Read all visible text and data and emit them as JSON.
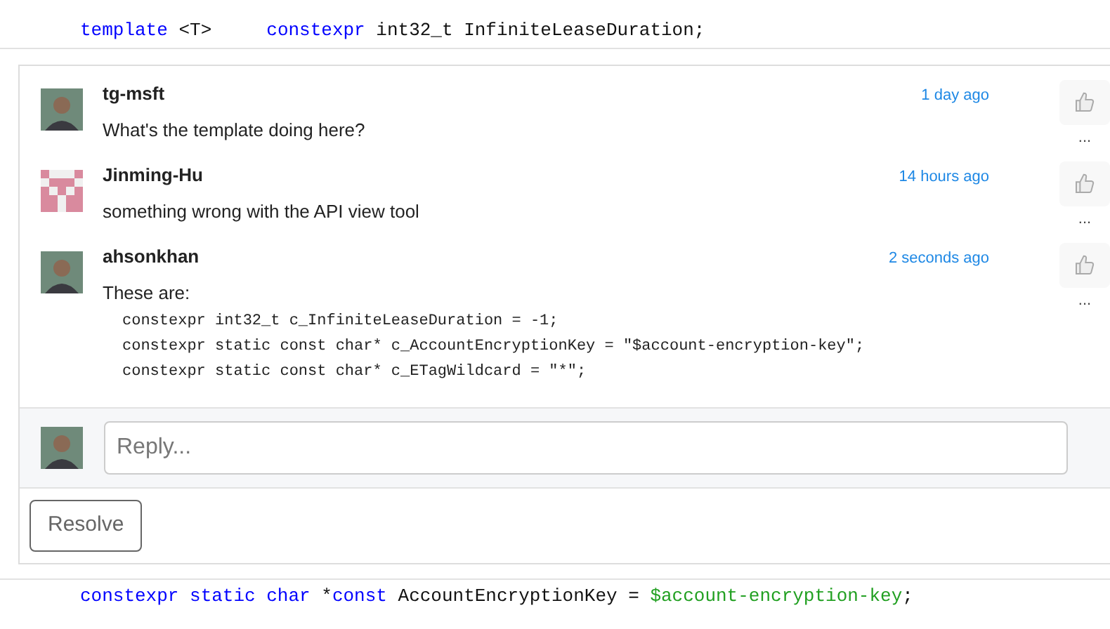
{
  "code_above": [
    {
      "text": "template",
      "kind": "keyword"
    },
    {
      "text": " <T>     ",
      "kind": "plain"
    },
    {
      "text": "constexpr",
      "kind": "keyword"
    },
    {
      "text": " int32_t InfiniteLeaseDuration;",
      "kind": "plain"
    }
  ],
  "comments": [
    {
      "author": "tg-msft",
      "time": "1 day ago",
      "avatar": {
        "kind": "photo"
      },
      "text": "What's the template doing here?",
      "more": "..."
    },
    {
      "author": "Jinming-Hu",
      "time": "14 hours ago",
      "avatar": {
        "kind": "identicon"
      },
      "text": "something wrong with the API view tool",
      "more": "..."
    },
    {
      "author": "ahsonkhan",
      "time": "2 seconds ago",
      "avatar": {
        "kind": "photo"
      },
      "text": "These are:",
      "code": [
        "constexpr int32_t c_InfiniteLeaseDuration = -1;",
        "constexpr static const char* c_AccountEncryptionKey = \"$account-encryption-key\";",
        "constexpr static const char* c_ETagWildcard = \"*\";"
      ],
      "more": "..."
    }
  ],
  "reply": {
    "placeholder": "Reply..."
  },
  "resolve_button": "Resolve",
  "code_below": [
    {
      "text": "constexpr",
      "kind": "keyword"
    },
    {
      "text": " static",
      "kind": "keyword"
    },
    {
      "text": " char",
      "kind": "keyword"
    },
    {
      "text": " *",
      "kind": "plain"
    },
    {
      "text": "const",
      "kind": "keyword"
    },
    {
      "text": " AccountEncryptionKey = ",
      "kind": "plain"
    },
    {
      "text": "$account-encryption-key",
      "kind": "string"
    },
    {
      "text": ";",
      "kind": "plain"
    }
  ]
}
